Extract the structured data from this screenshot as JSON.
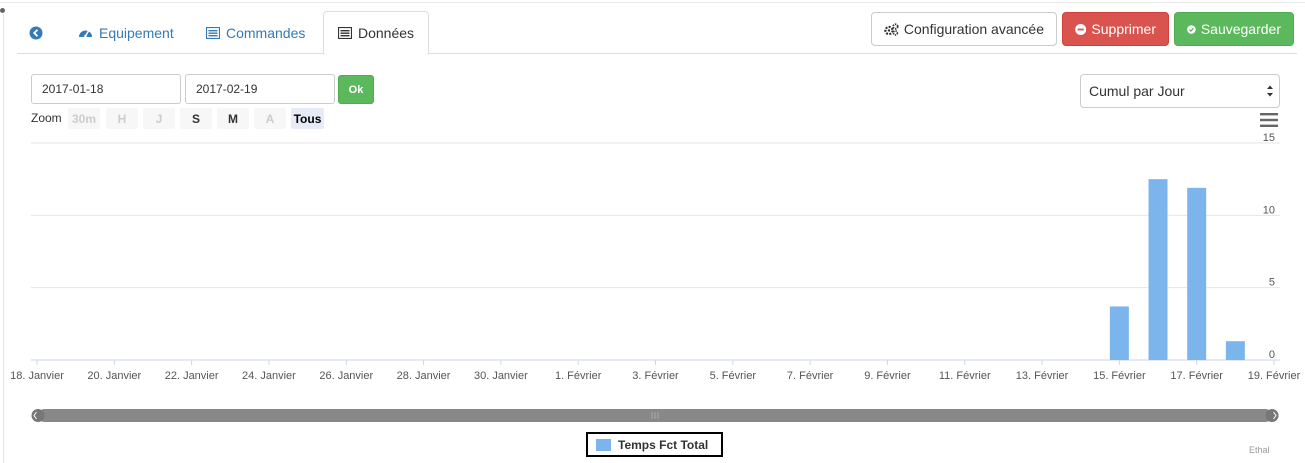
{
  "tabs": {
    "back_icon": "arrow-circle-left-icon",
    "equipement": {
      "icon": "tachometer-icon",
      "label": "Equipement"
    },
    "commandes": {
      "icon": "list-alt-icon",
      "label": "Commandes"
    },
    "donnees": {
      "icon": "list-alt-icon",
      "label": "Données"
    }
  },
  "actions": {
    "config": {
      "icon": "cogs-icon",
      "label": "Configuration avancée"
    },
    "delete": {
      "icon": "minus-circle-icon",
      "label": "Supprimer"
    },
    "save": {
      "icon": "check-circle-icon",
      "label": "Sauvegarder"
    }
  },
  "filters": {
    "start_date": "2017-01-18",
    "end_date": "2017-02-19",
    "ok_label": "Ok",
    "grouping_selected": "Cumul par Jour"
  },
  "zoom": {
    "label": "Zoom",
    "buttons": [
      {
        "label": "30m",
        "state": "disabled"
      },
      {
        "label": "H",
        "state": "disabled"
      },
      {
        "label": "J",
        "state": "disabled"
      },
      {
        "label": "S",
        "state": "enabled"
      },
      {
        "label": "M",
        "state": "enabled"
      },
      {
        "label": "A",
        "state": "disabled"
      },
      {
        "label": "Tous",
        "state": "active"
      }
    ]
  },
  "chart_data": {
    "type": "bar",
    "title": "",
    "xlabel": "",
    "ylabel": "",
    "ylim": [
      0,
      15
    ],
    "y_ticks": [
      0,
      5,
      10,
      15
    ],
    "x_tick_labels": [
      "18. Janvier",
      "20. Janvier",
      "22. Janvier",
      "24. Janvier",
      "26. Janvier",
      "28. Janvier",
      "30. Janvier",
      "1. Février",
      "3. Février",
      "5. Février",
      "7. Février",
      "9. Février",
      "11. Février",
      "13. Février",
      "15. Février",
      "17. Février",
      "19. Février"
    ],
    "x_range_days": [
      "2017-01-18",
      "2017-02-19"
    ],
    "series": [
      {
        "name": "Temps Fct Total",
        "color": "#7cb5ec",
        "points": [
          {
            "x": "2017-02-15",
            "y": 3.7
          },
          {
            "x": "2017-02-16",
            "y": 12.5
          },
          {
            "x": "2017-02-17",
            "y": 11.9
          },
          {
            "x": "2017-02-18",
            "y": 1.3
          }
        ]
      }
    ],
    "grid": true,
    "legend_position": "bottom-center",
    "credits": "Ethal"
  },
  "colors": {
    "danger": "#d9534f",
    "success": "#5cb85c",
    "link": "#337ab7",
    "series": "#7cb5ec"
  }
}
